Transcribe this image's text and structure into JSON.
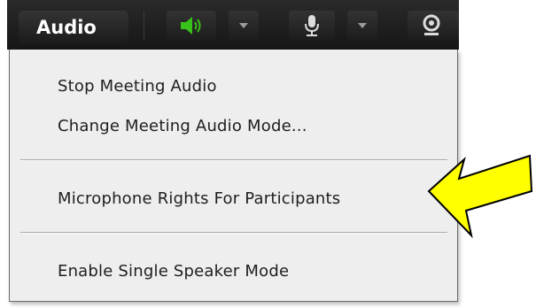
{
  "toolbar": {
    "audio_label": "Audio",
    "speaker_icon": "speaker-on-icon",
    "mic_icon": "microphone-icon",
    "webcam_icon": "webcam-icon",
    "dropdown_icon": "chevron-down-icon",
    "speaker_color": "#39c21a"
  },
  "menu": {
    "items": [
      {
        "label": "Stop Meeting Audio"
      },
      {
        "label": "Change Meeting Audio Mode..."
      },
      {
        "label": "Microphone Rights For Participants"
      },
      {
        "label": "Enable Single Speaker Mode"
      }
    ]
  },
  "annotation": {
    "arrow_color": "#ffff00",
    "arrow_direction": "left"
  }
}
